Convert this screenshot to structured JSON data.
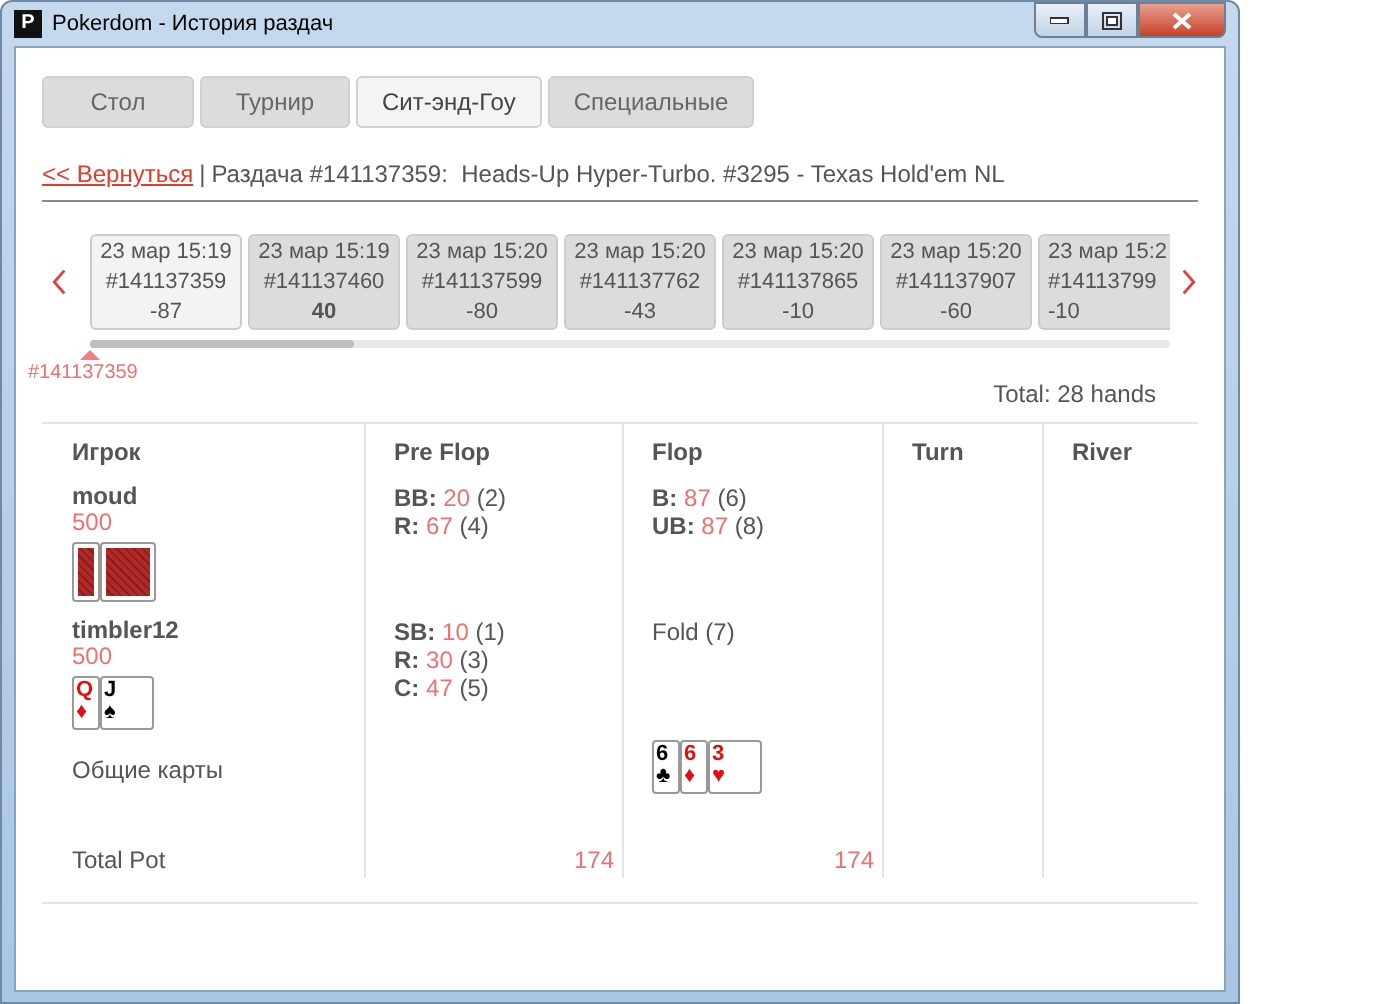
{
  "window": {
    "title": "Pokerdom - История раздач",
    "logo": "P"
  },
  "tabs": [
    {
      "label": "Стол",
      "selected": false
    },
    {
      "label": "Турнир",
      "selected": false
    },
    {
      "label": "Сит-энд-Гоу",
      "selected": true
    },
    {
      "label": "Специальные",
      "selected": false
    }
  ],
  "breadcrumb": {
    "back_link": "<< Вернуться",
    "separator": "|",
    "info": "Раздача #141137359:  Heads-Up Hyper-Turbo. #3295 - Texas Hold'em NL"
  },
  "hands": [
    {
      "time": "23 мар 15:19",
      "id": "#141137359",
      "result": "-87",
      "selected": true,
      "won": false
    },
    {
      "time": "23 мар 15:19",
      "id": "#141137460",
      "result": "40",
      "selected": false,
      "won": true
    },
    {
      "time": "23 мар 15:20",
      "id": "#141137599",
      "result": "-80",
      "selected": false,
      "won": false
    },
    {
      "time": "23 мар 15:20",
      "id": "#141137762",
      "result": "-43",
      "selected": false,
      "won": false
    },
    {
      "time": "23 мар 15:20",
      "id": "#141137865",
      "result": "-10",
      "selected": false,
      "won": false
    },
    {
      "time": "23 мар 15:20",
      "id": "#141137907",
      "result": "-60",
      "selected": false,
      "won": false
    },
    {
      "time": "23 мар 15:2",
      "id": "#14113799",
      "result": "-10",
      "selected": false,
      "won": false
    }
  ],
  "scroll_marker": "#141137359",
  "total": "Total: 28 hands",
  "table": {
    "columns": [
      "Игрок",
      "Pre Flop",
      "Flop",
      "Turn",
      "River"
    ],
    "players": [
      {
        "name": "moud",
        "stack": "500",
        "cards": [
          {
            "kind": "back"
          },
          {
            "kind": "back"
          }
        ],
        "preflop": [
          {
            "kind": "bet",
            "label": "BB:",
            "amount": "20",
            "order": "(2)"
          },
          {
            "kind": "bet",
            "label": "R:",
            "amount": "67",
            "order": "(4)"
          }
        ],
        "flop": [
          {
            "kind": "bet",
            "label": "B:",
            "amount": "87",
            "order": "(6)"
          },
          {
            "kind": "bet",
            "label": "UB:",
            "amount": "87",
            "order": "(8)"
          }
        ]
      },
      {
        "name": "timbler12",
        "stack": "500",
        "cards": [
          {
            "kind": "face",
            "rank": "Q",
            "suit": "♦",
            "color": "#e01010"
          },
          {
            "kind": "face",
            "rank": "J",
            "suit": "♠",
            "color": "#000000"
          }
        ],
        "preflop": [
          {
            "kind": "bet",
            "label": "SB:",
            "amount": "10",
            "order": "(1)"
          },
          {
            "kind": "bet",
            "label": "R:",
            "amount": "30",
            "order": "(3)"
          },
          {
            "kind": "bet",
            "label": "C:",
            "amount": "47",
            "order": "(5)"
          }
        ],
        "flop": [
          {
            "kind": "fold",
            "label": "Fold",
            "order": "(7)"
          }
        ]
      }
    ],
    "community": {
      "label": "Общие карты",
      "flop": [
        {
          "kind": "face",
          "rank": "6",
          "suit": "♣",
          "color": "#000000"
        },
        {
          "kind": "face",
          "rank": "6",
          "suit": "♦",
          "color": "#e01010"
        },
        {
          "kind": "face",
          "rank": "3",
          "suit": "♥",
          "color": "#e01010"
        }
      ]
    },
    "total_pot": {
      "label": "Total Pot",
      "preflop": "174",
      "flop": "174"
    }
  }
}
